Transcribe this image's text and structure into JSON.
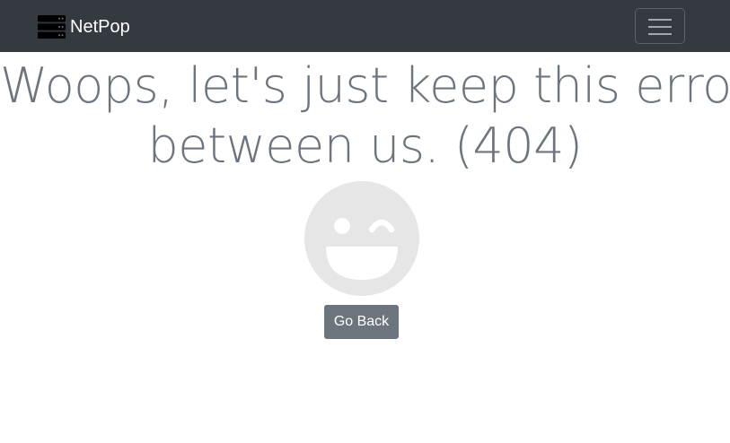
{
  "navbar": {
    "brand_name": "NetPop",
    "brand_icon": "server-icon",
    "menu_icon": "hamburger-icon",
    "background": "#343a40"
  },
  "main": {
    "headline_line1": "Woops, let's just keep this error",
    "headline_line2": "between us. (404)",
    "illustration_icon": "winking-face-icon",
    "go_back_label": "Go Back"
  },
  "colors": {
    "text_muted": "#6c757d",
    "face_gray": "#e6e6e6",
    "button_secondary": "#6c757d"
  }
}
